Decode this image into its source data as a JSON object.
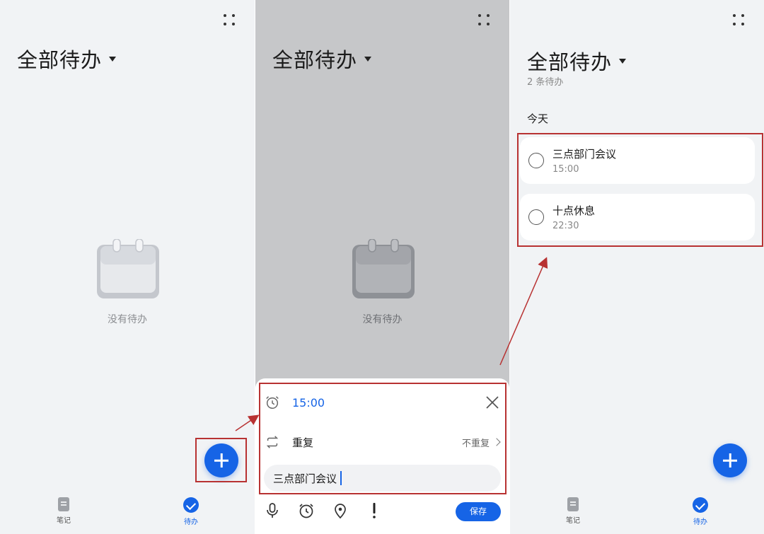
{
  "screen1": {
    "title": "全部待办",
    "empty_text": "没有待办",
    "nav": {
      "notes_label": "笔记",
      "todos_label": "待办"
    }
  },
  "screen2": {
    "title": "全部待办",
    "empty_text": "没有待办",
    "reminder_time": "15:00",
    "repeat_label": "重复",
    "repeat_value": "不重复",
    "task_input_value": "三点部门会议",
    "save_label": "保存"
  },
  "screen3": {
    "title": "全部待办",
    "count_text": "2 条待办",
    "section_label": "今天",
    "todos": [
      {
        "title": "三点部门会议",
        "time": "15:00"
      },
      {
        "title": "十点休息",
        "time": "22:30"
      }
    ],
    "nav": {
      "notes_label": "笔记",
      "todos_label": "待办"
    }
  },
  "colors": {
    "accent": "#1664e6",
    "highlight_box": "#b83232",
    "overlay": "#c6c7c9"
  },
  "icons": [
    "more-icon",
    "dropdown-caret-icon",
    "calendar-empty-icon",
    "plus-icon",
    "alarm-icon",
    "close-icon",
    "repeat-icon",
    "chevron-right-icon",
    "microphone-icon",
    "location-icon",
    "priority-icon",
    "note-icon",
    "check-circle-icon"
  ]
}
